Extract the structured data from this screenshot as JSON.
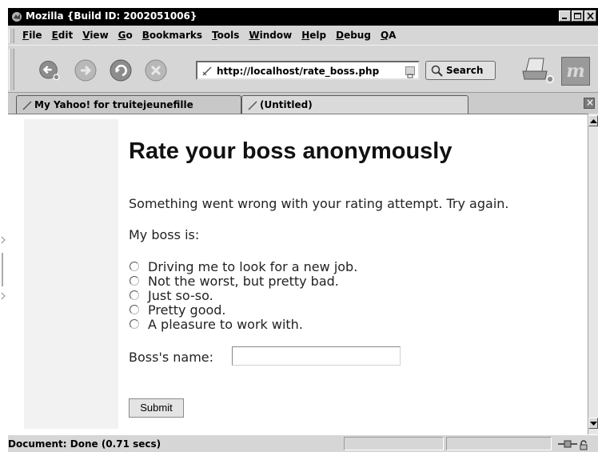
{
  "window": {
    "title": "Mozilla {Build ID: 2002051006}"
  },
  "menubar": {
    "items": [
      "File",
      "Edit",
      "View",
      "Go",
      "Bookmarks",
      "Tools",
      "Window",
      "Help",
      "Debug",
      "QA"
    ]
  },
  "toolbar": {
    "url": "http://localhost/rate_boss.php",
    "search_label": "Search"
  },
  "tabs": [
    {
      "label": "My Yahoo! for truitejeunefille",
      "active": false
    },
    {
      "label": "(Untitled)",
      "active": true
    }
  ],
  "page": {
    "heading": "Rate your boss anonymously",
    "error_message": "Something went wrong with your rating attempt. Try again.",
    "prompt": "My boss is:",
    "options": [
      "Driving me to look for a new job.",
      "Not the worst, but pretty bad.",
      "Just so-so.",
      "Pretty good.",
      "A pleasure to work with."
    ],
    "name_label": "Boss's name:",
    "name_value": "",
    "submit_label": "Submit"
  },
  "status": {
    "text": "Document: Done (0.71 secs)"
  },
  "icons": {
    "back": "back-arrow-icon",
    "forward": "forward-arrow-icon",
    "reload": "reload-icon",
    "stop": "stop-icon",
    "search": "magnifier-icon",
    "print": "printer-icon",
    "logo": "mozilla-m-icon"
  }
}
